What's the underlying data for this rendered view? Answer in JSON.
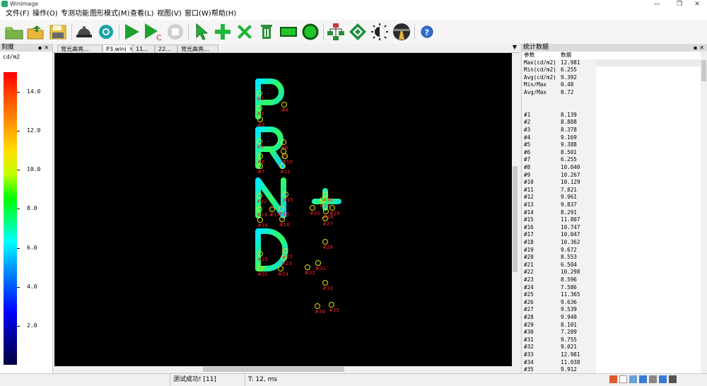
{
  "window": {
    "title": "WinImage"
  },
  "menu": [
    "文件(F)",
    "操作(O)",
    "专测功能",
    "图形模式(M)",
    "查看(L)",
    "视图(V)",
    "窗口(W)",
    "帮助(H)"
  ],
  "toolbar_icons": [
    "open-folder-icon",
    "open-file-icon",
    "save-icon",
    "camera-dome-icon",
    "settings-gear-icon",
    "play-icon",
    "play-continuous-icon",
    "stop-icon",
    "select-arrow-icon",
    "add-point-icon",
    "delete-point-icon",
    "trash-icon",
    "rectangle-tool-icon",
    "circle-tool-icon",
    "hierarchy-icon",
    "grid-pattern-icon",
    "brightness-icon",
    "road-icon",
    "help-icon"
  ],
  "scale_panel": {
    "title": "刻度",
    "unit": "cd/m2",
    "ticks": [
      "14.0",
      "12.0",
      "10.0",
      "8.0",
      "6.0",
      "4.0",
      "2.0"
    ],
    "colors": {
      "top": "#ff0000",
      "high": "#ff8000",
      "mid_high": "#ffff00",
      "mid": "#00ff00",
      "mid_low": "#00ffff",
      "low": "#0000ff",
      "bottom": "#000033"
    }
  },
  "tabs": [
    "背光高亮...",
    "P3.wini",
    "11...",
    "22...",
    "背光高亮..."
  ],
  "stats_panel": {
    "title": "统计数据",
    "headers": [
      "参数",
      "数据"
    ],
    "summary": [
      [
        "Max(cd/m2)",
        "12.981"
      ],
      [
        "Min(cd/m2)",
        "6.255"
      ],
      [
        "Avg(cd/m2)",
        "9.392"
      ],
      [
        "Min/Max",
        "0.48"
      ],
      [
        "Avg/Max",
        "0.72"
      ]
    ],
    "points": [
      [
        "#1",
        "8.139"
      ],
      [
        "#2",
        "8.888"
      ],
      [
        "#3",
        "8.378"
      ],
      [
        "#4",
        "9.169"
      ],
      [
        "#5",
        "9.388"
      ],
      [
        "#6",
        "8.501"
      ],
      [
        "#7",
        "6.255"
      ],
      [
        "#8",
        "10.040"
      ],
      [
        "#9",
        "10.267"
      ],
      [
        "#10",
        "10.129"
      ],
      [
        "#11",
        "7.821"
      ],
      [
        "#12",
        "9.961"
      ],
      [
        "#13",
        "9.837"
      ],
      [
        "#14",
        "8.291"
      ],
      [
        "#15",
        "11.807"
      ],
      [
        "#16",
        "10.747"
      ],
      [
        "#17",
        "10.047"
      ],
      [
        "#18",
        "10.362"
      ],
      [
        "#19",
        "9.672"
      ],
      [
        "#20",
        "8.553"
      ],
      [
        "#21",
        "6.504"
      ],
      [
        "#22",
        "10.298"
      ],
      [
        "#23",
        "8.596"
      ],
      [
        "#24",
        "7.586"
      ],
      [
        "#25",
        "11.365"
      ],
      [
        "#26",
        "9.636"
      ],
      [
        "#27",
        "9.539"
      ],
      [
        "#28",
        "9.940"
      ],
      [
        "#29",
        "8.101"
      ],
      [
        "#30",
        "7.289"
      ],
      [
        "#31",
        "9.755"
      ],
      [
        "#32",
        "9.021"
      ],
      [
        "#33",
        "12.981"
      ],
      [
        "#34",
        "11.938"
      ],
      [
        "#35",
        "9.912"
      ]
    ]
  },
  "canvas": {
    "glyph_letters": [
      "P",
      "R",
      "N",
      "D"
    ],
    "marker_labels": [
      "#1",
      "#2",
      "#3",
      "#4",
      "#5",
      "#6",
      "#7",
      "#8",
      "#9",
      "#10",
      "#11",
      "#12",
      "#13",
      "#14",
      "#15",
      "#16",
      "#17",
      "#18",
      "#19",
      "#20",
      "#21",
      "#22",
      "#23",
      "#24",
      "#25",
      "#26",
      "#27",
      "#28",
      "#29",
      "#30",
      "#31",
      "#32",
      "#33",
      "#34",
      "#35"
    ]
  },
  "status": {
    "message": "测试成功! [11]",
    "timing": "T: 12, ms"
  }
}
